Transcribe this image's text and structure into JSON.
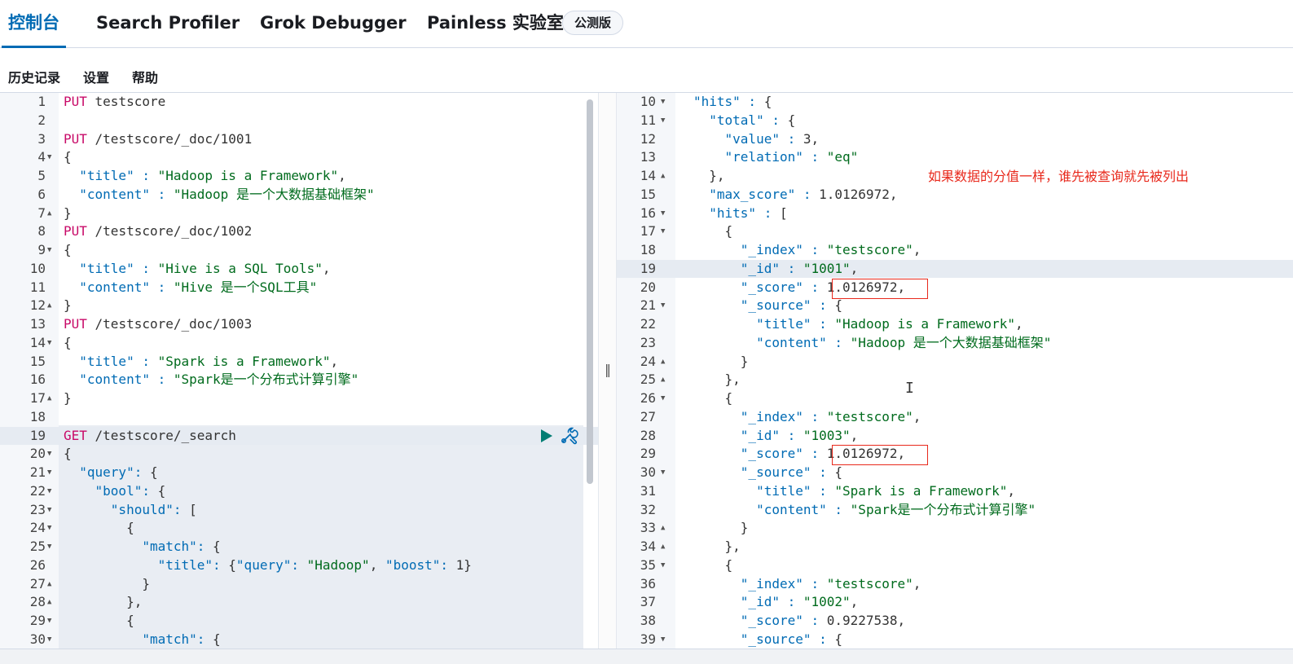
{
  "tabs": [
    {
      "label": "控制台",
      "active": true
    },
    {
      "label": "Search Profiler",
      "active": false
    },
    {
      "label": "Grok Debugger",
      "active": false
    },
    {
      "label": "Painless 实验室",
      "active": false
    }
  ],
  "beta_badge": "公测版",
  "menu": [
    "历史记录",
    "设置",
    "帮助"
  ],
  "annotation": "如果数据的分值一样，谁先被查询就先被列出",
  "colors": {
    "accent": "#006bb4",
    "keyword": "#c80a68",
    "string": "#006b1d",
    "annotation": "#e8291c"
  },
  "request": [
    {
      "n": "1",
      "fold": "",
      "text": "PUT testscore"
    },
    {
      "n": "2",
      "fold": "",
      "text": ""
    },
    {
      "n": "3",
      "fold": "",
      "text": "PUT /testscore/_doc/1001"
    },
    {
      "n": "4",
      "fold": "▼",
      "text": "{"
    },
    {
      "n": "5",
      "fold": "",
      "text": "  \"title\" : \"Hadoop is a Framework\","
    },
    {
      "n": "6",
      "fold": "",
      "text": "  \"content\" : \"Hadoop 是一个大数据基础框架\""
    },
    {
      "n": "7",
      "fold": "▲",
      "text": "}"
    },
    {
      "n": "8",
      "fold": "",
      "text": "PUT /testscore/_doc/1002"
    },
    {
      "n": "9",
      "fold": "▼",
      "text": "{"
    },
    {
      "n": "10",
      "fold": "",
      "text": "  \"title\" : \"Hive is a SQL Tools\","
    },
    {
      "n": "11",
      "fold": "",
      "text": "  \"content\" : \"Hive 是一个SQL工具\""
    },
    {
      "n": "12",
      "fold": "▲",
      "text": "}"
    },
    {
      "n": "13",
      "fold": "",
      "text": "PUT /testscore/_doc/1003"
    },
    {
      "n": "14",
      "fold": "▼",
      "text": "{"
    },
    {
      "n": "15",
      "fold": "",
      "text": "  \"title\" : \"Spark is a Framework\","
    },
    {
      "n": "16",
      "fold": "",
      "text": "  \"content\" : \"Spark是一个分布式计算引擎\""
    },
    {
      "n": "17",
      "fold": "▲",
      "text": "}"
    },
    {
      "n": "18",
      "fold": "",
      "text": ""
    },
    {
      "n": "19",
      "fold": "",
      "text": "GET /testscore/_search"
    },
    {
      "n": "20",
      "fold": "▼",
      "text": "{"
    },
    {
      "n": "21",
      "fold": "▼",
      "text": "  \"query\": {"
    },
    {
      "n": "22",
      "fold": "▼",
      "text": "    \"bool\": {"
    },
    {
      "n": "23",
      "fold": "▼",
      "text": "      \"should\": ["
    },
    {
      "n": "24",
      "fold": "▼",
      "text": "        {"
    },
    {
      "n": "25",
      "fold": "▼",
      "text": "          \"match\": {"
    },
    {
      "n": "26",
      "fold": "",
      "text": "            \"title\": {\"query\": \"Hadoop\", \"boost\": 1}"
    },
    {
      "n": "27",
      "fold": "▲",
      "text": "          }"
    },
    {
      "n": "28",
      "fold": "▲",
      "text": "        },"
    },
    {
      "n": "29",
      "fold": "▼",
      "text": "        {"
    },
    {
      "n": "30",
      "fold": "▼",
      "text": "          \"match\": {"
    }
  ],
  "response": [
    {
      "n": "10",
      "fold": "▼",
      "text": "\"hits\" : {"
    },
    {
      "n": "11",
      "fold": "▼",
      "text": "  \"total\" : {"
    },
    {
      "n": "12",
      "fold": "",
      "text": "    \"value\" : 3,"
    },
    {
      "n": "13",
      "fold": "",
      "text": "    \"relation\" : \"eq\""
    },
    {
      "n": "14",
      "fold": "▲",
      "text": "  },"
    },
    {
      "n": "15",
      "fold": "",
      "text": "  \"max_score\" : 1.0126972,"
    },
    {
      "n": "16",
      "fold": "▼",
      "text": "  \"hits\" : ["
    },
    {
      "n": "17",
      "fold": "▼",
      "text": "    {"
    },
    {
      "n": "18",
      "fold": "",
      "text": "      \"_index\" : \"testscore\","
    },
    {
      "n": "19",
      "fold": "",
      "text": "      \"_id\" : \"1001\","
    },
    {
      "n": "20",
      "fold": "",
      "text": "      \"_score\" : 1.0126972,"
    },
    {
      "n": "21",
      "fold": "▼",
      "text": "      \"_source\" : {"
    },
    {
      "n": "22",
      "fold": "",
      "text": "        \"title\" : \"Hadoop is a Framework\","
    },
    {
      "n": "23",
      "fold": "",
      "text": "        \"content\" : \"Hadoop 是一个大数据基础框架\""
    },
    {
      "n": "24",
      "fold": "▲",
      "text": "      }"
    },
    {
      "n": "25",
      "fold": "▲",
      "text": "    },"
    },
    {
      "n": "26",
      "fold": "▼",
      "text": "    {"
    },
    {
      "n": "27",
      "fold": "",
      "text": "      \"_index\" : \"testscore\","
    },
    {
      "n": "28",
      "fold": "",
      "text": "      \"_id\" : \"1003\","
    },
    {
      "n": "29",
      "fold": "",
      "text": "      \"_score\" : 1.0126972,"
    },
    {
      "n": "30",
      "fold": "▼",
      "text": "      \"_source\" : {"
    },
    {
      "n": "31",
      "fold": "",
      "text": "        \"title\" : \"Spark is a Framework\","
    },
    {
      "n": "32",
      "fold": "",
      "text": "        \"content\" : \"Spark是一个分布式计算引擎\""
    },
    {
      "n": "33",
      "fold": "▲",
      "text": "      }"
    },
    {
      "n": "34",
      "fold": "▲",
      "text": "    },"
    },
    {
      "n": "35",
      "fold": "▼",
      "text": "    {"
    },
    {
      "n": "36",
      "fold": "",
      "text": "      \"_index\" : \"testscore\","
    },
    {
      "n": "37",
      "fold": "",
      "text": "      \"_id\" : \"1002\","
    },
    {
      "n": "38",
      "fold": "",
      "text": "      \"_score\" : 0.9227538,"
    },
    {
      "n": "39",
      "fold": "▼",
      "text": "      \"_source\" : {"
    }
  ]
}
